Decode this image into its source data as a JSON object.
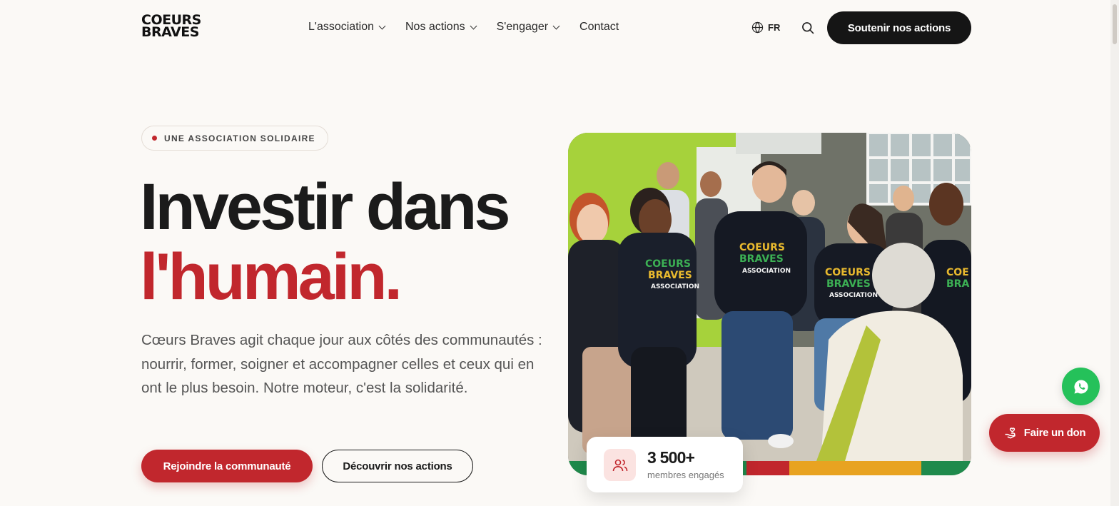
{
  "header": {
    "logo_line1": "COEURS",
    "logo_line2": "BRAVES",
    "nav": [
      {
        "label": "L'association",
        "dropdown": true
      },
      {
        "label": "Nos actions",
        "dropdown": true
      },
      {
        "label": "S'engager",
        "dropdown": true
      },
      {
        "label": "Contact",
        "dropdown": false
      }
    ],
    "language": "FR",
    "cta": "Soutenir nos actions"
  },
  "hero": {
    "badge": "UNE ASSOCIATION SOLIDAIRE",
    "title_line1": "Investir dans",
    "title_line2": "l'humain.",
    "lead": "Cœurs Braves agit chaque jour aux côtés des communautés : nourrir, former, soigner et accompagner celles et ceux qui en ont le plus besoin. Notre moteur, c'est la solidarité.",
    "primary_button": "Rejoindre la communauté",
    "secondary_button": "Découvrir nos actions"
  },
  "stat": {
    "value": "3 500+",
    "label": "membres engagés",
    "icon": "users-icon"
  },
  "photo": {
    "shirt_line1": "COEURS",
    "shirt_line2": "BRAVES",
    "shirt_line3": "ASSOCIATION"
  },
  "floating": {
    "whatsapp_icon": "whatsapp-icon",
    "donate_label": "Faire un don"
  },
  "colors": {
    "brand_red": "#c1272d",
    "dark": "#151515",
    "whatsapp_green": "#25c15a",
    "stripe_green": "#1f8a4c",
    "stripe_yellow": "#e8a321"
  }
}
